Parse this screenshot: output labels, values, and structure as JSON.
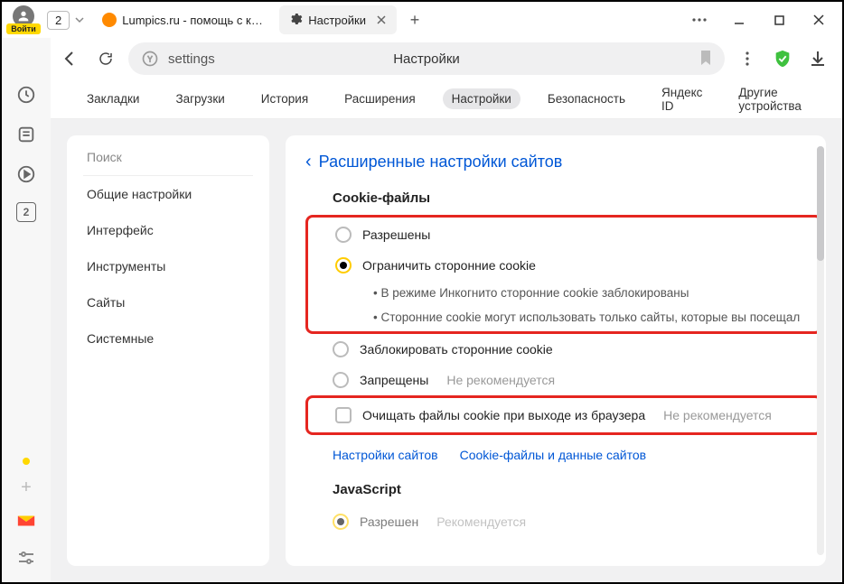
{
  "titlebar": {
    "login_label": "Войти",
    "tab_count": "2",
    "tabs": [
      {
        "title": "Lumpics.ru - помощь с ком",
        "favicon_color": "#ff8a00"
      },
      {
        "title": "Настройки",
        "active": true
      }
    ]
  },
  "addrbar": {
    "url_text": "settings",
    "center_label": "Настройки"
  },
  "vsidebar": {
    "box_number": "2"
  },
  "topnav": {
    "items": [
      "Закладки",
      "Загрузки",
      "История",
      "Расширения",
      "Настройки",
      "Безопасность",
      "Яндекс ID",
      "Другие устройства"
    ],
    "active_index": 4
  },
  "side_panel": {
    "search_label": "Поиск",
    "items": [
      "Общие настройки",
      "Интерфейс",
      "Инструменты",
      "Сайты",
      "Системные"
    ]
  },
  "main": {
    "breadcrumb": "Расширенные настройки сайтов",
    "cookie_section": {
      "title": "Cookie-файлы",
      "opt_allowed": "Разрешены",
      "opt_limit": "Ограничить сторонние cookie",
      "limit_note1": "В режиме Инкогнито сторонние cookie заблокированы",
      "limit_note2": "Сторонние cookie могут использовать только сайты, которые вы посещал",
      "opt_block3p": "Заблокировать сторонние cookie",
      "opt_forbidden": "Запрещены",
      "not_recommended": "Не рекомендуется",
      "opt_clear_exit": "Очищать файлы cookie при выходе из браузера",
      "link_site_settings": "Настройки сайтов",
      "link_cookie_data": "Cookie-файлы и данные сайтов"
    },
    "js_section": {
      "title": "JavaScript",
      "opt_allowed": "Разрешен",
      "recommended": "Рекомендуется"
    }
  }
}
